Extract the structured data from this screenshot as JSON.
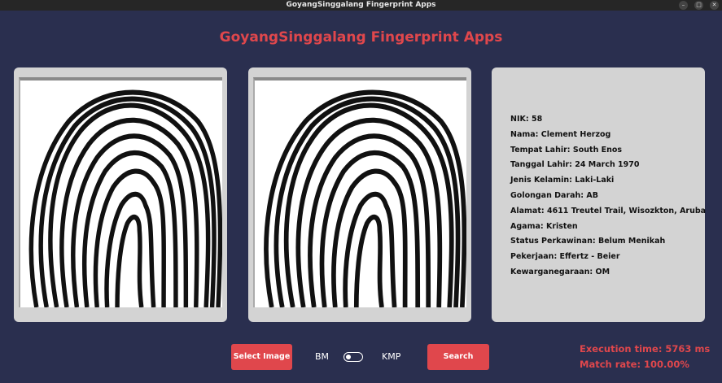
{
  "window": {
    "title": "GoyangSinggalang Fingerprint Apps",
    "controls": [
      "minimize-icon",
      "maximize-icon",
      "close-icon"
    ]
  },
  "app": {
    "heading": "GoyangSinggalang Fingerprint Apps"
  },
  "colors": {
    "background": "#2a2f4f",
    "accent": "#e0474c",
    "panel": "#d3d3d3"
  },
  "info": {
    "nik": "NIK: 58",
    "nama": "Nama: Clement Herzog",
    "tempat_lahir": "Tempat Lahir: South Enos",
    "tanggal_lahir": "Tanggal Lahir: 24 March 1970",
    "jenis_kelamin": "Jenis Kelamin: Laki-Laki",
    "golongan_darah": "Golongan Darah: AB",
    "alamat": "Alamat: 4611 Treutel Trail, Wisozkton, Aruba",
    "agama": "Agama: Kristen",
    "status_perkawinan": "Status Perkawinan: Belum Menikah",
    "pekerjaan": "Pekerjaan: Effertz - Beier",
    "kewarganegaraan": "Kewarganegaraan: OM"
  },
  "controls": {
    "select_image_label": "Select Image",
    "algo_left": "BM",
    "algo_right": "KMP",
    "toggle_state": "BM",
    "search_label": "Search"
  },
  "stats": {
    "execution_time": "Execution time: 5763 ms",
    "match_rate": "Match rate: 100.00%"
  }
}
